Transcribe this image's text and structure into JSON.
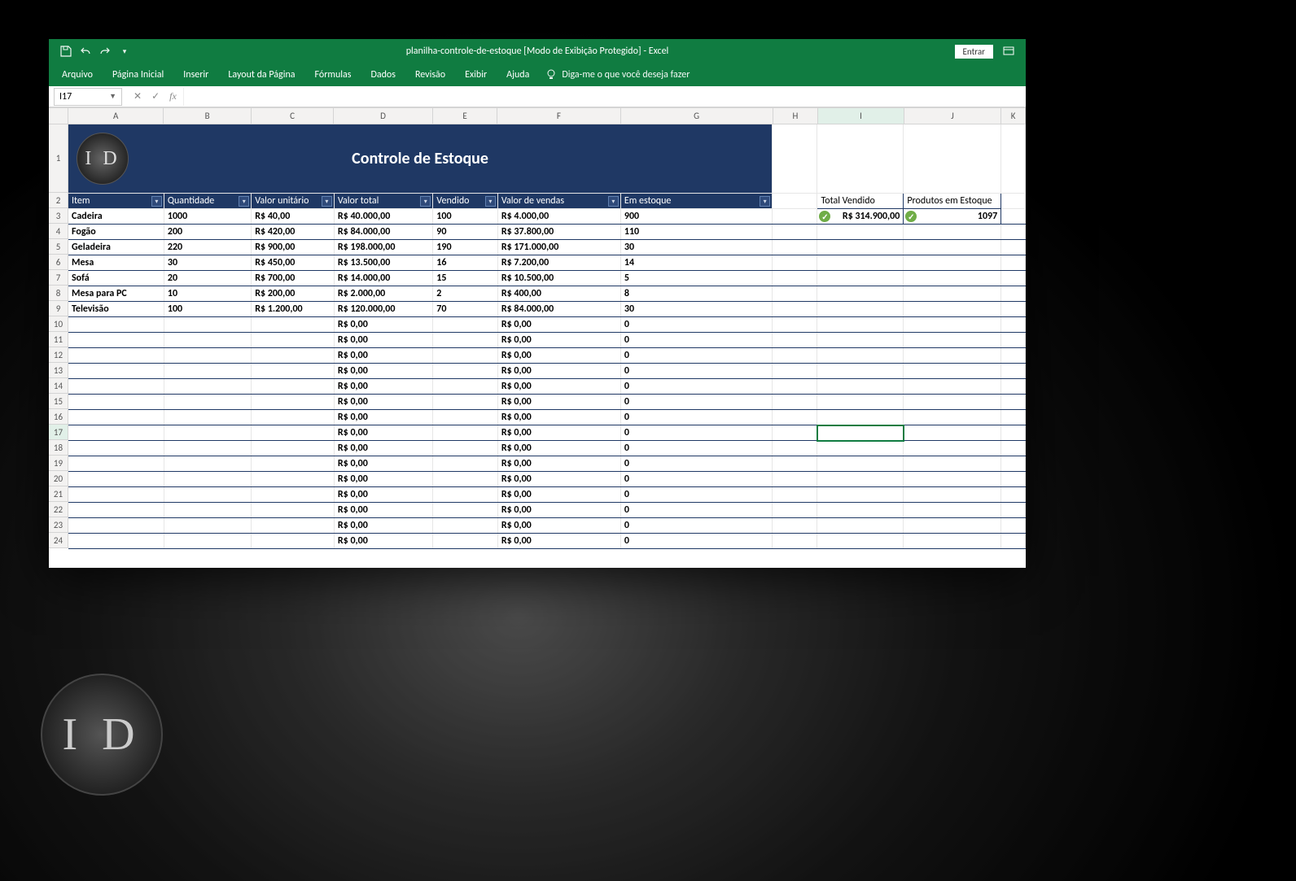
{
  "app": {
    "title": "planilha-controle-de-estoque  [Modo de Exibição Protegido]  -  Excel",
    "signin": "Entrar"
  },
  "menu": [
    "Arquivo",
    "Página Inicial",
    "Inserir",
    "Layout da Página",
    "Fórmulas",
    "Dados",
    "Revisão",
    "Exibir",
    "Ajuda"
  ],
  "tell_me": "Diga-me o que você deseja fazer",
  "namebox": "I17",
  "columns": [
    "A",
    "B",
    "C",
    "D",
    "E",
    "F",
    "G",
    "H",
    "I",
    "J",
    "K"
  ],
  "col_widths": [
    "col-A",
    "col-B",
    "col-C",
    "col-D",
    "col-E",
    "col-F",
    "col-G",
    "col-H",
    "col-I",
    "col-J",
    "col-K"
  ],
  "banner": {
    "title": "Controle de Estoque",
    "logo": "I D"
  },
  "table_headers": [
    "Item",
    "Quantidade",
    "Valor unitário",
    "Valor total",
    "Vendido",
    "Valor  de vendas",
    "Em estoque"
  ],
  "rows": [
    {
      "n": "3",
      "item": "Cadeira",
      "qtd": "1000",
      "unit": "R$ 40,00",
      "total": "R$ 40.000,00",
      "vend": "100",
      "vvend": "R$ 4.000,00",
      "est": "900"
    },
    {
      "n": "4",
      "item": "Fogão",
      "qtd": "200",
      "unit": "R$ 420,00",
      "total": "R$ 84.000,00",
      "vend": "90",
      "vvend": "R$ 37.800,00",
      "est": "110"
    },
    {
      "n": "5",
      "item": "Geladeira",
      "qtd": "220",
      "unit": "R$ 900,00",
      "total": "R$ 198.000,00",
      "vend": "190",
      "vvend": "R$ 171.000,00",
      "est": "30"
    },
    {
      "n": "6",
      "item": "Mesa",
      "qtd": "30",
      "unit": "R$ 450,00",
      "total": "R$ 13.500,00",
      "vend": "16",
      "vvend": "R$ 7.200,00",
      "est": "14"
    },
    {
      "n": "7",
      "item": "Sofá",
      "qtd": "20",
      "unit": "R$ 700,00",
      "total": "R$ 14.000,00",
      "vend": "15",
      "vvend": "R$ 10.500,00",
      "est": "5"
    },
    {
      "n": "8",
      "item": "Mesa para PC",
      "qtd": "10",
      "unit": "R$ 200,00",
      "total": "R$ 2.000,00",
      "vend": "2",
      "vvend": "R$ 400,00",
      "est": "8"
    },
    {
      "n": "9",
      "item": "Televisão",
      "qtd": "100",
      "unit": "R$ 1.200,00",
      "total": "R$ 120.000,00",
      "vend": "70",
      "vvend": "R$ 84.000,00",
      "est": "30"
    },
    {
      "n": "10",
      "item": "",
      "qtd": "",
      "unit": "",
      "total": "R$ 0,00",
      "vend": "",
      "vvend": "R$ 0,00",
      "est": "0"
    },
    {
      "n": "11",
      "item": "",
      "qtd": "",
      "unit": "",
      "total": "R$ 0,00",
      "vend": "",
      "vvend": "R$ 0,00",
      "est": "0"
    },
    {
      "n": "12",
      "item": "",
      "qtd": "",
      "unit": "",
      "total": "R$ 0,00",
      "vend": "",
      "vvend": "R$ 0,00",
      "est": "0"
    },
    {
      "n": "13",
      "item": "",
      "qtd": "",
      "unit": "",
      "total": "R$ 0,00",
      "vend": "",
      "vvend": "R$ 0,00",
      "est": "0"
    },
    {
      "n": "14",
      "item": "",
      "qtd": "",
      "unit": "",
      "total": "R$ 0,00",
      "vend": "",
      "vvend": "R$ 0,00",
      "est": "0"
    },
    {
      "n": "15",
      "item": "",
      "qtd": "",
      "unit": "",
      "total": "R$ 0,00",
      "vend": "",
      "vvend": "R$ 0,00",
      "est": "0"
    },
    {
      "n": "16",
      "item": "",
      "qtd": "",
      "unit": "",
      "total": "R$ 0,00",
      "vend": "",
      "vvend": "R$ 0,00",
      "est": "0"
    },
    {
      "n": "17",
      "item": "",
      "qtd": "",
      "unit": "",
      "total": "R$ 0,00",
      "vend": "",
      "vvend": "R$ 0,00",
      "est": "0"
    },
    {
      "n": "18",
      "item": "",
      "qtd": "",
      "unit": "",
      "total": "R$ 0,00",
      "vend": "",
      "vvend": "R$ 0,00",
      "est": "0"
    },
    {
      "n": "19",
      "item": "",
      "qtd": "",
      "unit": "",
      "total": "R$ 0,00",
      "vend": "",
      "vvend": "R$ 0,00",
      "est": "0"
    },
    {
      "n": "20",
      "item": "",
      "qtd": "",
      "unit": "",
      "total": "R$ 0,00",
      "vend": "",
      "vvend": "R$ 0,00",
      "est": "0"
    },
    {
      "n": "21",
      "item": "",
      "qtd": "",
      "unit": "",
      "total": "R$ 0,00",
      "vend": "",
      "vvend": "R$ 0,00",
      "est": "0"
    },
    {
      "n": "22",
      "item": "",
      "qtd": "",
      "unit": "",
      "total": "R$ 0,00",
      "vend": "",
      "vvend": "R$ 0,00",
      "est": "0"
    },
    {
      "n": "23",
      "item": "",
      "qtd": "",
      "unit": "",
      "total": "R$ 0,00",
      "vend": "",
      "vvend": "R$ 0,00",
      "est": "0"
    },
    {
      "n": "24",
      "item": "",
      "qtd": "",
      "unit": "",
      "total": "R$ 0,00",
      "vend": "",
      "vvend": "R$ 0,00",
      "est": "0"
    }
  ],
  "summary": {
    "h1": "Total Vendido",
    "h2": "Produtos em Estoque",
    "v1": "R$ 314.900,00",
    "v2": "1097"
  },
  "watermark": "I D",
  "active_row": "17"
}
